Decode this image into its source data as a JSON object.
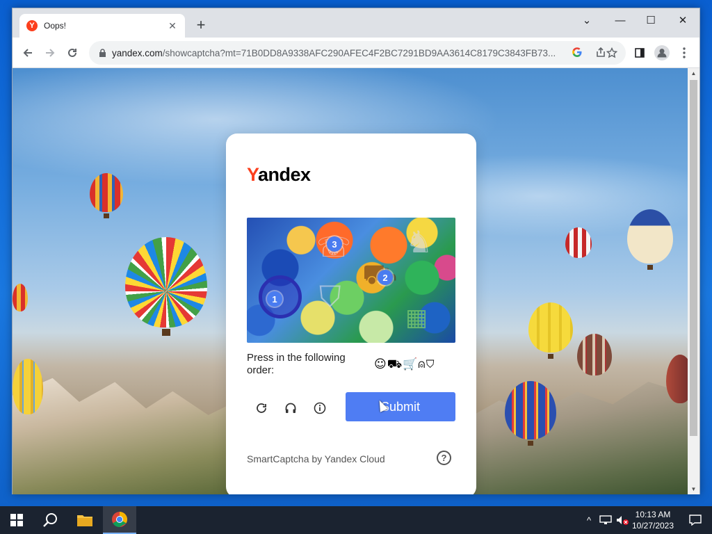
{
  "browser": {
    "tab_title": "Oops!",
    "tab_favicon": "Y",
    "tab_close": "✕",
    "new_tab": "+",
    "url_main": "yandex.com",
    "url_path": "/showcaptcha?mt=71B0DD8A9338AFC290AFEC4F2BC7291BD9AA3614C8179C3843FB73...",
    "window_controls": {
      "minimize": "—",
      "maximize": "☐",
      "close": "✕",
      "tab_menu": "⌄"
    }
  },
  "captcha": {
    "brand_first": "Y",
    "brand_rest": "andex",
    "instruction": "Press in the following order:",
    "order_icons": "☺⛟🛒⍝⛉",
    "markers": [
      "1",
      "2",
      "3"
    ],
    "submit_label": "Submit",
    "footer": "SmartCaptcha by Yandex Cloud",
    "help_label": "?"
  },
  "icons": {
    "back": "arrow-left-icon",
    "forward": "arrow-right-icon",
    "reload": "reload-icon",
    "lock": "lock-icon",
    "google": "google-icon",
    "share": "share-icon",
    "bookmark": "star-icon",
    "sidepanel": "side-panel-icon",
    "profile": "profile-icon",
    "menu": "kebab-menu-icon",
    "refresh_captcha": "refresh-icon",
    "audio": "headphones-icon",
    "info": "info-icon"
  },
  "taskbar": {
    "time": "10:13 AM",
    "date": "10/27/2023"
  },
  "colors": {
    "yandex_red": "#fc3f1d",
    "submit_blue": "#4f7df3",
    "marker_blue": "#4a7cf0"
  }
}
